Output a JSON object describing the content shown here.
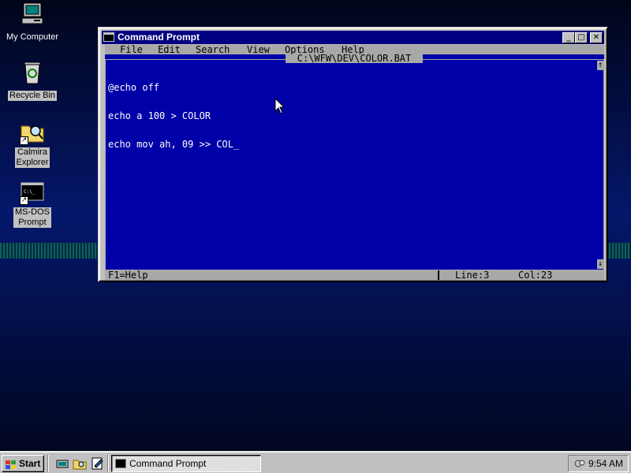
{
  "desktop": {
    "icons": [
      {
        "label": "My Computer"
      },
      {
        "label": "Recycle Bin"
      },
      {
        "label_line1": "Calmira",
        "label_line2": "Explorer"
      },
      {
        "label_line1": "MS-DOS",
        "label_line2": "Prompt"
      }
    ]
  },
  "window": {
    "title": "Command Prompt",
    "min_glyph": "_",
    "max_glyph": "□",
    "close_glyph": "✕"
  },
  "editor": {
    "menu": [
      "File",
      "Edit",
      "Search",
      "View",
      "Options",
      "Help"
    ],
    "filename": "C:\\WFW\\DEV\\COLOR.BAT",
    "lines": [
      "@echo off",
      "echo a 100 > COLOR",
      "echo mov ah, 09 >> COL_"
    ],
    "scroll_up": "↑",
    "scroll_down": "↓",
    "status": {
      "help": "F1=Help",
      "line": "Line:3",
      "col": "Col:23"
    }
  },
  "taskbar": {
    "start_label": "Start",
    "task_label": "Command Prompt",
    "clock": "9:54 AM"
  },
  "colors": {
    "console_bg": "#0000a8",
    "titlebar": "#000080",
    "chrome": "#c0c0c0"
  },
  "icon_names": [
    "computer-icon",
    "recycle-bin-icon",
    "explorer-folder-icon",
    "ms-dos-icon",
    "windows-logo-icon",
    "mouse-pointer-icon"
  ]
}
